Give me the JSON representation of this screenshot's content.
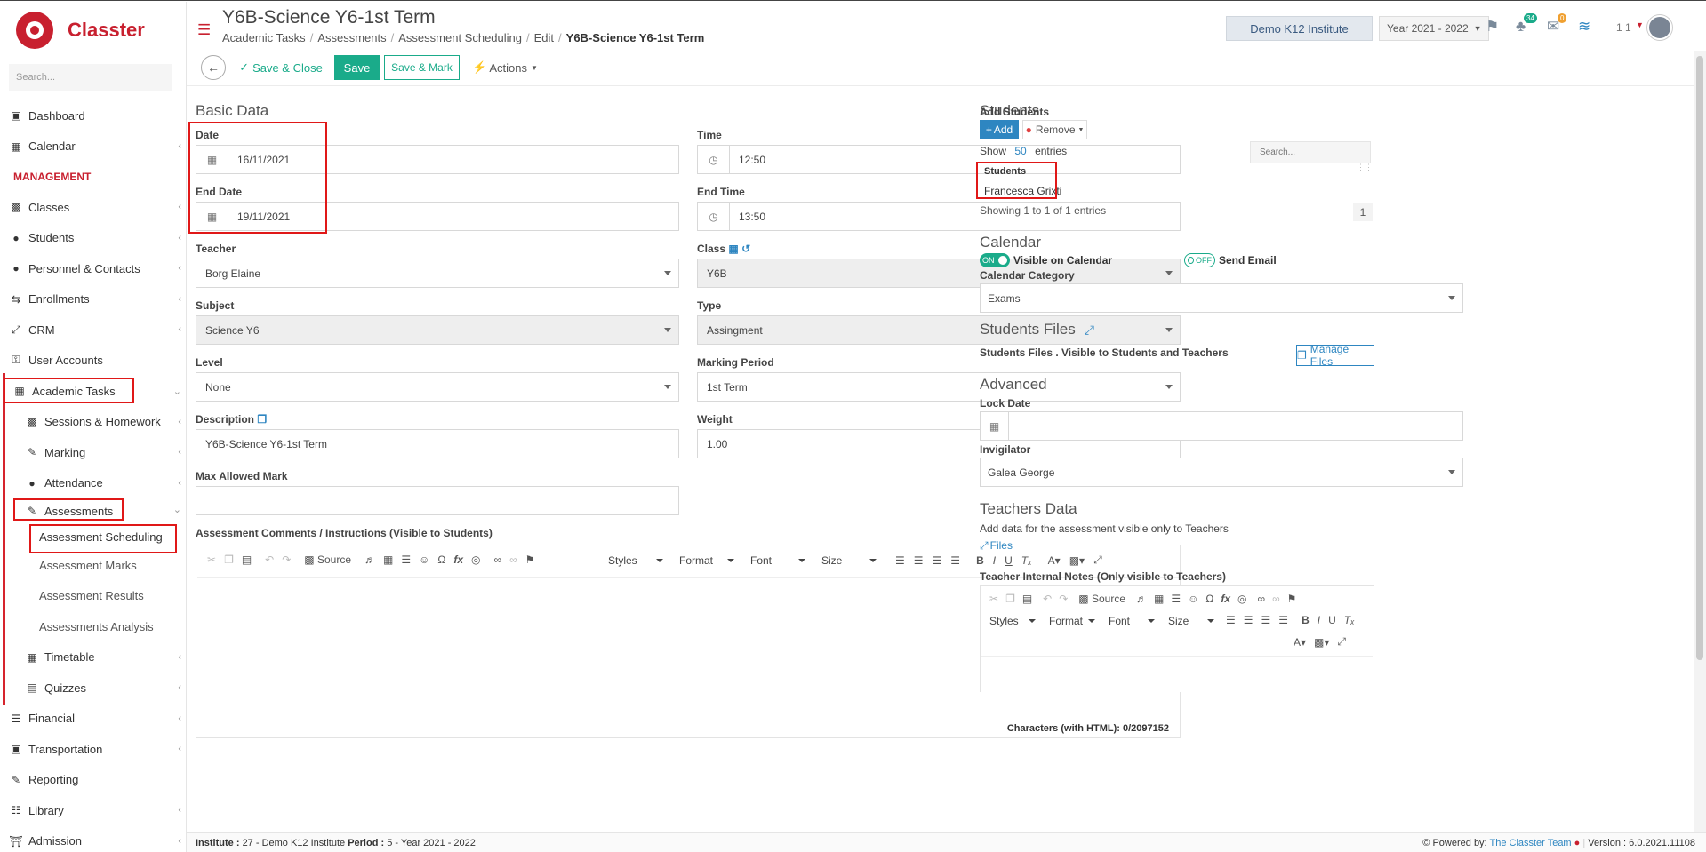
{
  "app": {
    "name": "Classter",
    "search_placeholder": "Search..."
  },
  "sidebar": {
    "items": [
      {
        "label": "Dashboard",
        "icon": "laptop-icon"
      },
      {
        "label": "Calendar",
        "icon": "calendar-icon"
      },
      {
        "label": "MANAGEMENT",
        "section": true
      },
      {
        "label": "Classes",
        "icon": "classes-icon"
      },
      {
        "label": "Students",
        "icon": "students-icon"
      },
      {
        "label": "Personnel & Contacts",
        "icon": "person-icon"
      },
      {
        "label": "Enrollments",
        "icon": "exchange-icon"
      },
      {
        "label": "CRM",
        "icon": "crm-icon"
      },
      {
        "label": "User Accounts",
        "icon": "key-icon"
      },
      {
        "label": "Academic Tasks",
        "icon": "grid-icon"
      },
      {
        "label": "Sessions & Homework",
        "icon": "sessions-icon"
      },
      {
        "label": "Marking",
        "icon": "edit-icon"
      },
      {
        "label": "Attendance",
        "icon": "attendance-icon"
      },
      {
        "label": "Assessments",
        "icon": "assessment-icon"
      },
      {
        "label": "Assessment Scheduling"
      },
      {
        "label": "Assessment Marks"
      },
      {
        "label": "Assessment Results"
      },
      {
        "label": "Assessments Analysis"
      },
      {
        "label": "Timetable",
        "icon": "timetable-icon"
      },
      {
        "label": "Quizzes",
        "icon": "quiz-icon"
      },
      {
        "label": "Financial",
        "icon": "coins-icon"
      },
      {
        "label": "Transportation",
        "icon": "bus-icon"
      },
      {
        "label": "Reporting",
        "icon": "reporting-icon"
      },
      {
        "label": "Library",
        "icon": "library-icon"
      },
      {
        "label": "Admission",
        "icon": "bank-icon"
      }
    ]
  },
  "header": {
    "title": "Y6B-Science Y6-1st Term",
    "breadcrumb": [
      "Academic Tasks",
      "Assessments",
      "Assessment Scheduling",
      "Edit",
      "Y6B-Science Y6-1st Term"
    ],
    "institute": "Demo K12 Institute",
    "year": "Year 2021 - 2022",
    "notifications_count": "34",
    "messages_count": "0",
    "user_label": "1 1"
  },
  "toolbar": {
    "save_close": "Save & Close",
    "save": "Save",
    "save_mark": "Save & Mark",
    "actions": "Actions"
  },
  "basic": {
    "title": "Basic Data",
    "date_label": "Date",
    "date": "16/11/2021",
    "time_label": "Time",
    "time": "12:50",
    "end_date_label": "End Date",
    "end_date": "19/11/2021",
    "end_time_label": "End Time",
    "end_time": "13:50",
    "teacher_label": "Teacher",
    "teacher": "Borg Elaine",
    "class_label": "Class",
    "class": "Y6B",
    "subject_label": "Subject",
    "subject": "Science Y6",
    "type_label": "Type",
    "type": "Assingment",
    "level_label": "Level",
    "level": "None",
    "period_label": "Marking Period",
    "period": "1st Term",
    "desc_label": "Description",
    "desc": "Y6B-Science Y6-1st Term",
    "weight_label": "Weight",
    "weight": "1.00",
    "max_label": "Max Allowed Mark",
    "max": "",
    "comments_label": "Assessment Comments / Instructions (Visible to Students)",
    "chars": "Characters (with HTML): 0/2097152"
  },
  "editor": {
    "source": "Source",
    "styles": "Styles",
    "format": "Format",
    "font": "Font",
    "size": "Size"
  },
  "students": {
    "title": "Students",
    "add_label": "Add Students",
    "add_btn": "Add",
    "remove_btn": "Remove",
    "show": "Show",
    "entries_count": "50",
    "entries": "entries",
    "search_placeholder": "Search...",
    "col_header": "Students",
    "rows": [
      "Francesca Grixti"
    ],
    "showing": "Showing 1 to 1 of 1 entries",
    "page": "1"
  },
  "calendar": {
    "title": "Calendar",
    "on": "ON",
    "visible": "Visible on Calendar",
    "off": "OFF",
    "send_email": "Send Email",
    "category_label": "Calendar Category",
    "category": "Exams"
  },
  "files": {
    "title": "Students Files",
    "desc": "Students Files . Visible to Students and Teachers",
    "manage": "Manage Files"
  },
  "advanced": {
    "title": "Advanced",
    "lock_label": "Lock Date",
    "lock": "",
    "invigilator_label": "Invigilator",
    "invigilator": "Galea George"
  },
  "teachers": {
    "title": "Teachers Data",
    "desc": "Add data for the assessment visible only to Teachers",
    "files": "Files",
    "notes_label": "Teacher Internal Notes (Only visible to Teachers)"
  },
  "footer": {
    "inst_label": "Institute :",
    "inst": "27 - Demo K12 Institute",
    "period_label": "Period :",
    "period": "5 - Year 2021 - 2022",
    "powered": "Powered by:",
    "team": "The Classter Team",
    "version": "Version : 6.0.2021.11108"
  },
  "colors": {
    "brand": "#c8202f",
    "accent": "#1aab8a",
    "primary": "#2e86c1",
    "highlight": "#e01818"
  }
}
